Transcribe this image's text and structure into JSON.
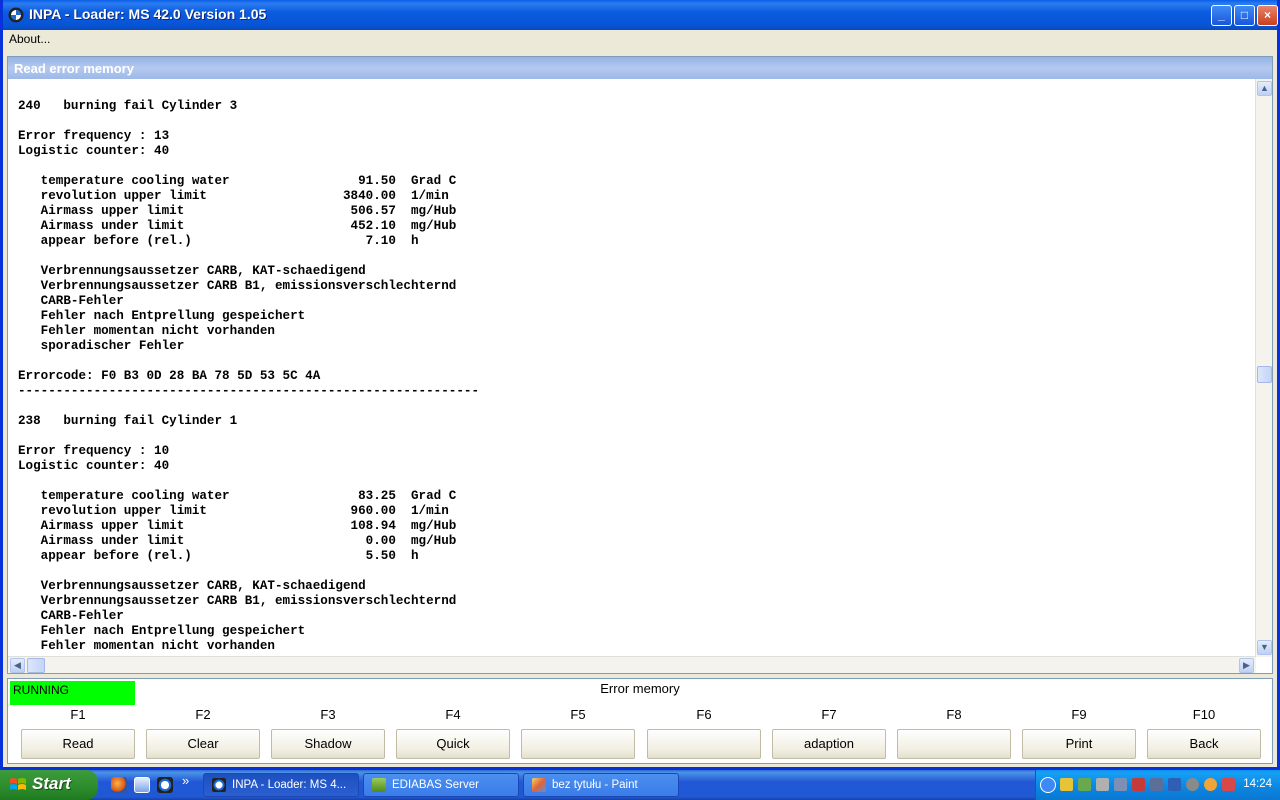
{
  "window": {
    "title": "INPA - Loader:  MS 42.0 Version 1.05",
    "minimize": "_",
    "maximize": "□",
    "close": "×"
  },
  "menu": {
    "about": "About..."
  },
  "panel": {
    "header": "Read error memory",
    "lines": [
      "240   burning fail Cylinder 3",
      "",
      "Error frequency : 13",
      "Logistic counter: 40",
      "",
      "   temperature cooling water                 91.50  Grad C",
      "   revolution upper limit                  3840.00  1/min",
      "   Airmass upper limit                      506.57  mg/Hub",
      "   Airmass under limit                      452.10  mg/Hub",
      "   appear before (rel.)                       7.10  h",
      "",
      "   Verbrennungsaussetzer CARB, KAT-schaedigend",
      "   Verbrennungsaussetzer CARB B1, emissionsverschlechternd",
      "   CARB-Fehler",
      "   Fehler nach Entprellung gespeichert",
      "   Fehler momentan nicht vorhanden",
      "   sporadischer Fehler",
      "",
      "Errorcode: F0 B3 0D 28 BA 78 5D 53 5C 4A",
      "-------------------------------------------------------------",
      "",
      "238   burning fail Cylinder 1",
      "",
      "Error frequency : 10",
      "Logistic counter: 40",
      "",
      "   temperature cooling water                 83.25  Grad C",
      "   revolution upper limit                   960.00  1/min",
      "   Airmass upper limit                      108.94  mg/Hub",
      "   Airmass under limit                        0.00  mg/Hub",
      "   appear before (rel.)                       5.50  h",
      "",
      "   Verbrennungsaussetzer CARB, KAT-schaedigend",
      "   Verbrennungsaussetzer CARB B1, emissionsverschlechternd",
      "   CARB-Fehler",
      "   Fehler nach Entprellung gespeichert",
      "   Fehler momentan nicht vorhanden"
    ]
  },
  "status": {
    "state": "RUNNING",
    "state_color": "#00ff00",
    "title": "Error memory"
  },
  "fkeys": [
    {
      "key": "F1",
      "label": "Read"
    },
    {
      "key": "F2",
      "label": "Clear"
    },
    {
      "key": "F3",
      "label": "Shadow"
    },
    {
      "key": "F4",
      "label": "Quick"
    },
    {
      "key": "F5",
      "label": ""
    },
    {
      "key": "F6",
      "label": ""
    },
    {
      "key": "F7",
      "label": "adaption"
    },
    {
      "key": "F8",
      "label": ""
    },
    {
      "key": "F9",
      "label": "Print"
    },
    {
      "key": "F10",
      "label": "Back"
    }
  ],
  "taskbar": {
    "start": "Start",
    "quicklaunch_more": "»",
    "tasks": [
      {
        "label": "INPA - Loader:  MS 4...",
        "active": true
      },
      {
        "label": "EDIABAS Server",
        "active": false
      },
      {
        "label": "bez tytułu - Paint",
        "active": false
      }
    ],
    "clock": "14:24"
  }
}
